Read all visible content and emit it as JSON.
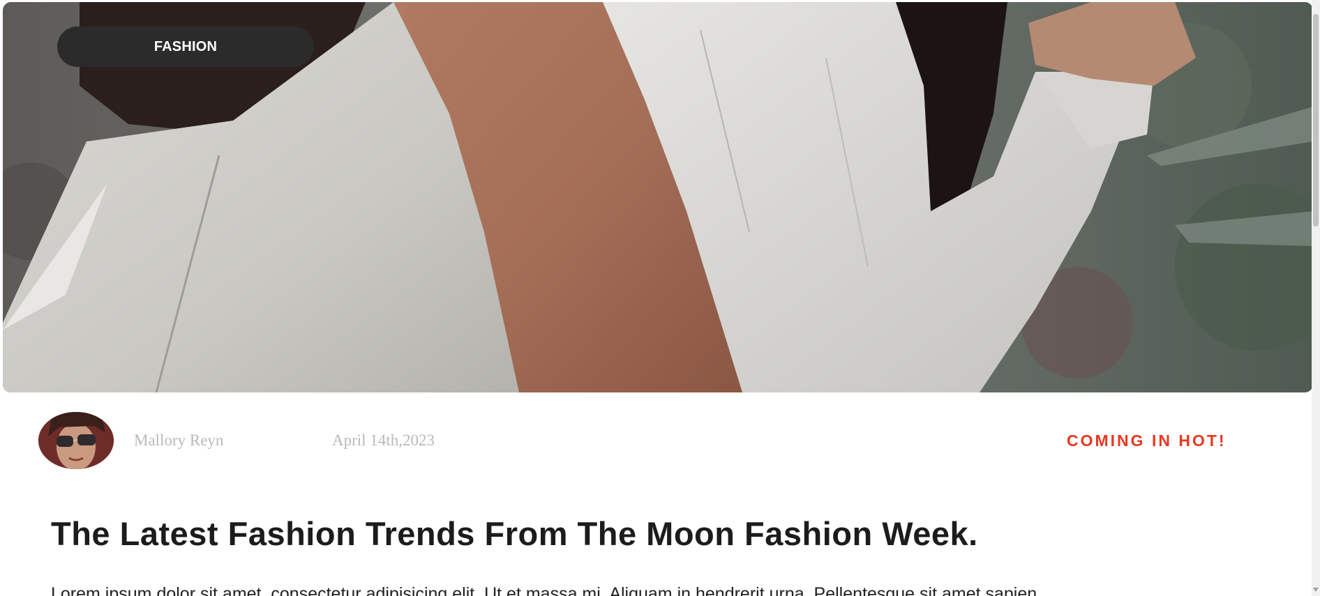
{
  "hero": {
    "category_label": "FASHION",
    "image_subject": "two-people-in-white-clothing"
  },
  "meta": {
    "author_name": "Mallory Reyn",
    "date": "April 14th,2023",
    "tag": "COMING IN HOT!"
  },
  "article": {
    "title": "The Latest Fashion Trends From The Moon Fashion Week.",
    "body_start": "Lorem ipsum dolor sit amet, consectetur adipisicing elit. Ut et massa mi. Aliquam in hendrerit urna. Pellentesque sit amet sapien"
  },
  "colors": {
    "accent": "#e8371f",
    "pill_bg": "#2b2b2b",
    "title": "#1c1c1c",
    "muted": "#b9b9b9"
  }
}
